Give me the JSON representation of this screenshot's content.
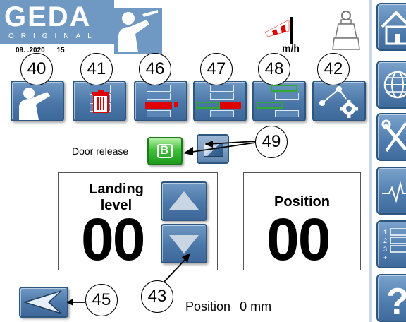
{
  "header": {
    "logo_text": "GEDA",
    "logo_sub": "ORIGINAL",
    "date": "09.  .2020",
    "time": "15",
    "wind_unit": "m/h"
  },
  "toolbar": {
    "buttons": [
      {
        "callout": "40",
        "icon": "operator-icon"
      },
      {
        "callout": "41",
        "icon": "trash-icon"
      },
      {
        "callout": "46",
        "icon": "level-delete-icon"
      },
      {
        "callout": "47",
        "icon": "level-add-delete-icon"
      },
      {
        "callout": "48",
        "icon": "level-list-icon"
      },
      {
        "callout": "42",
        "icon": "settings-icon"
      }
    ]
  },
  "door": {
    "label": "Door release",
    "b_label": "B",
    "callout": "49"
  },
  "landing": {
    "label_line1": "Landing",
    "label_line2": "level",
    "value": "00",
    "callout": "43"
  },
  "position_panel": {
    "label": "Position",
    "value": "00"
  },
  "footer": {
    "back_callout": "45",
    "position_label": "Position",
    "position_value": "0 mm"
  },
  "colors": {
    "accent_blue": "#4b77a8",
    "red": "#e00000",
    "green": "#2eaa2e"
  }
}
